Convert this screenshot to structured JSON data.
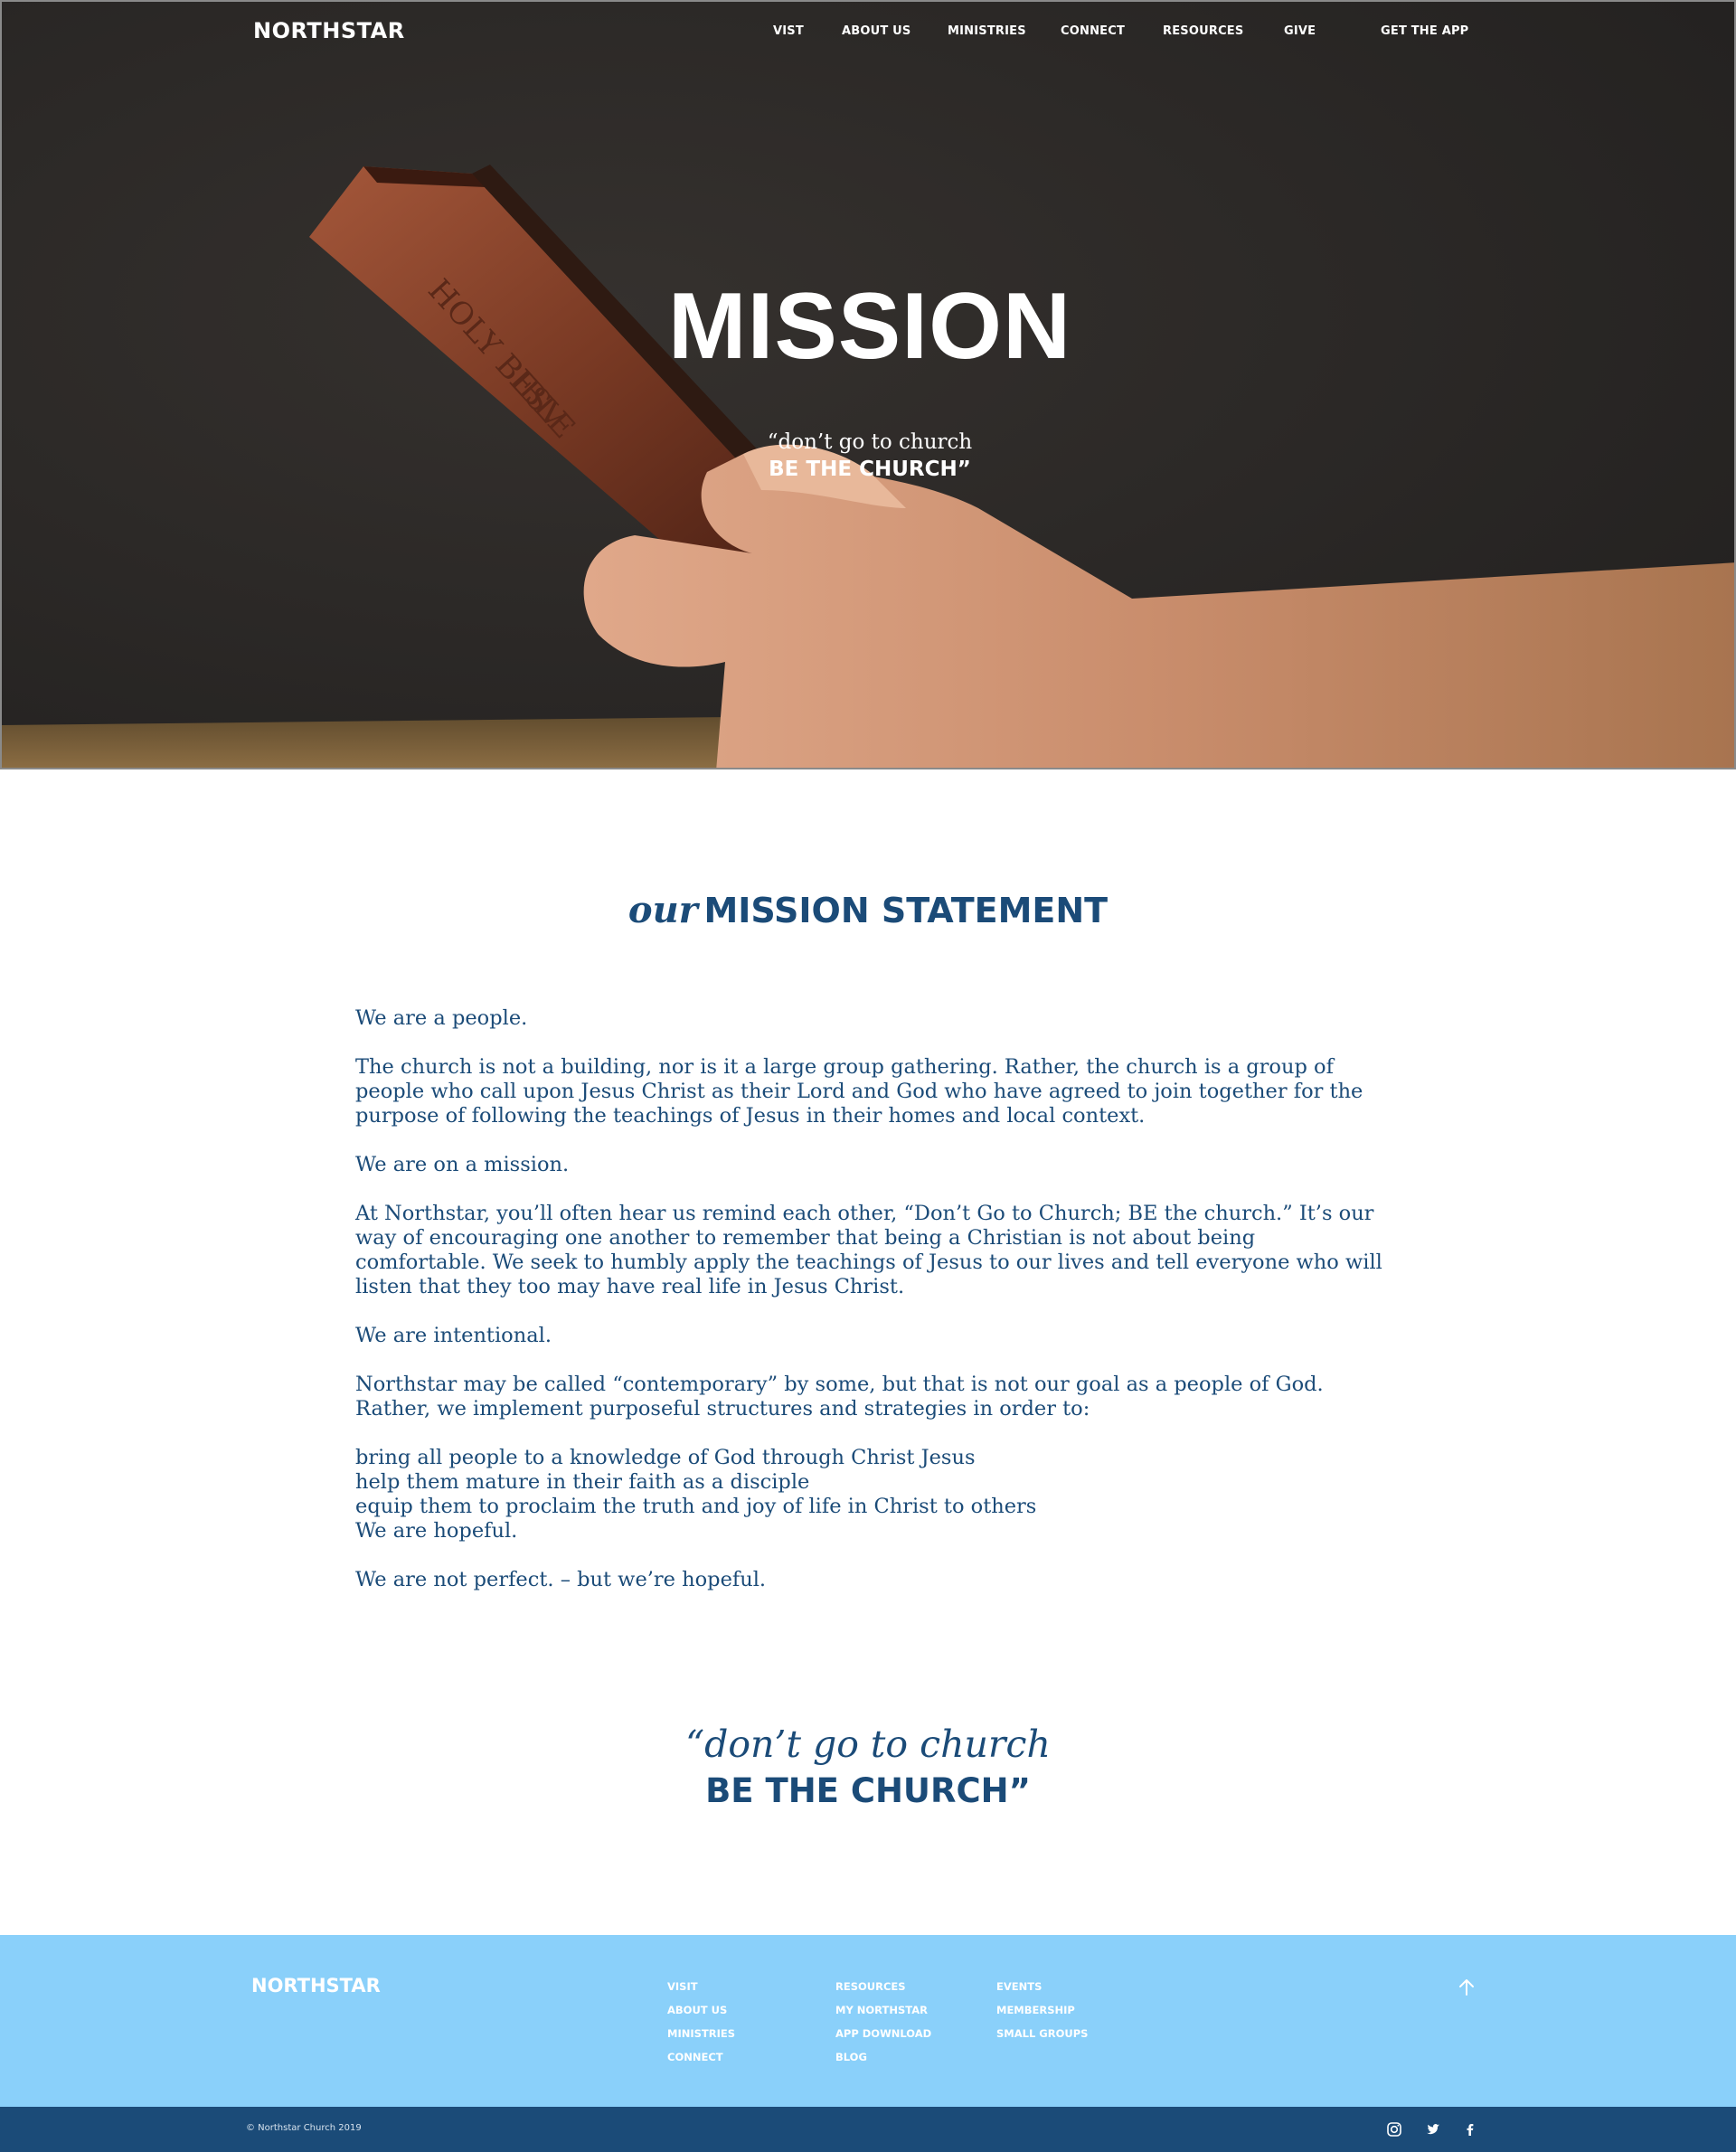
{
  "nav": {
    "brand": "NORTHSTAR",
    "links": [
      "VIST",
      "ABOUT US",
      "MINISTRIES",
      "CONNECT",
      "RESOURCES",
      "GIVE"
    ],
    "cta": "GET THE APP"
  },
  "hero": {
    "title": "MISSION",
    "quote_line1": "“don’t go to church",
    "quote_line2": "BE THE CHURCH”",
    "photo_description_icon": "bible-in-hand-photo"
  },
  "mission": {
    "heading_italic": "our",
    "heading_bold": "MISSION STATEMENT",
    "paragraphs": [
      "We are a people.",
      "The church is not a building, nor is it a large group gathering. Rather, the church is a group of people who call upon Jesus Christ as their Lord and God who have agreed to join together for the purpose of following the teachings of Jesus in their homes and local context.",
      "We are on a mission.",
      "At Northstar, you’ll often hear us remind each other, “Don’t Go to Church; BE the church.” It’s our way of encouraging one another to remember that being a Christian is not about being comfortable. We seek to humbly apply the teachings of Jesus to our lives and tell everyone who will listen that they too may have real life in Jesus Christ.",
      "We are intentional.",
      "Northstar may be called “contemporary” by some, but that is not our goal as a people of God. Rather, we implement purposeful structures and strategies in order to:"
    ],
    "list": [
      "bring all people to a knowledge of God through Christ Jesus",
      "help them mature in their faith as a disciple",
      "equip them to proclaim the truth and joy of life in Christ to others",
      "We are hopeful."
    ],
    "closing": "We are not perfect. – but we’re hopeful."
  },
  "quote": {
    "line1": "“don’t go to church",
    "line2": "BE THE CHURCH”"
  },
  "footer": {
    "brand": "NORTHSTAR",
    "col1": [
      "VISIT",
      "ABOUT US",
      "MINISTRIES",
      "CONNECT"
    ],
    "col2": [
      "RESOURCES",
      "MY NORTHSTAR",
      "APP DOWNLOAD",
      "BLOG"
    ],
    "col3": [
      "EVENTS",
      "MEMBERSHIP",
      "SMALL GROUPS"
    ],
    "copyright": "© Northstar Church 2019",
    "social_icons": [
      "instagram-icon",
      "twitter-icon",
      "facebook-icon"
    ]
  },
  "colors": {
    "brand_blue": "#1b4b78",
    "footer_light_blue": "#8ad0fa",
    "hero_dark": "#2a2826"
  }
}
